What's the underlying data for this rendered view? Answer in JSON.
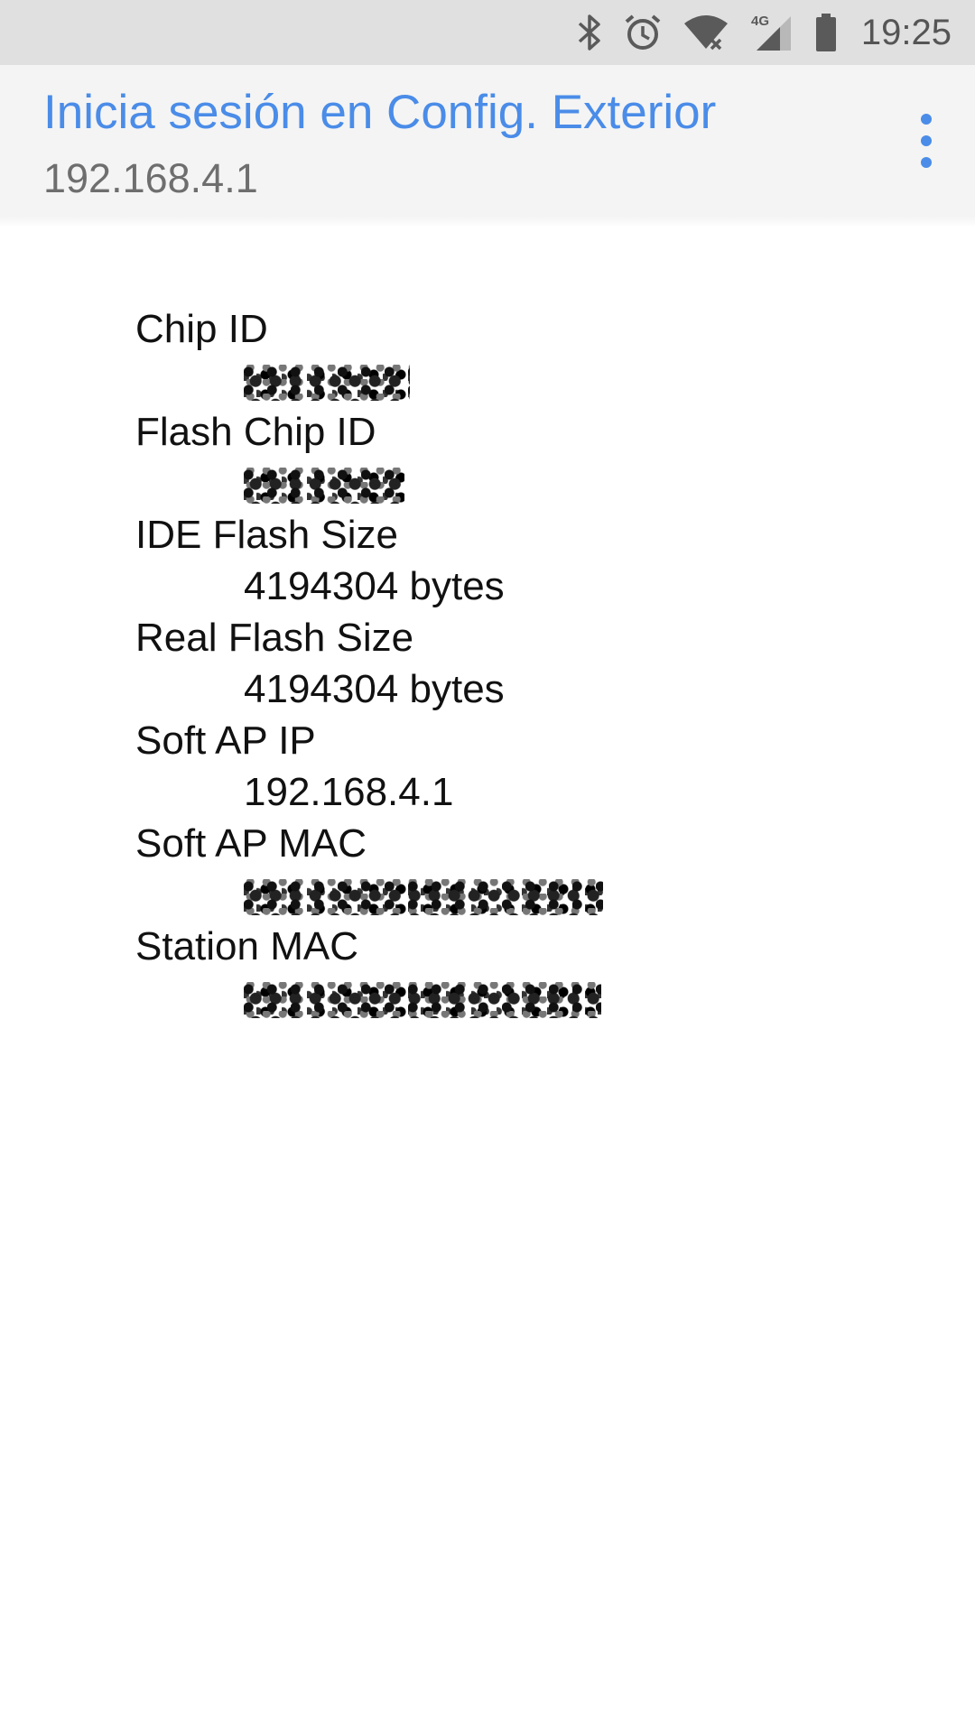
{
  "status_bar": {
    "time": "19:25",
    "icons": [
      "bluetooth-icon",
      "alarm-icon",
      "wifi-no-internet-icon",
      "signal-4g-icon",
      "battery-icon"
    ],
    "network_type": "4G"
  },
  "app_bar": {
    "title": "Inicia sesión en Config. Exterior",
    "subtitle": "192.168.4.1",
    "menu_icon": "more-vert-icon",
    "accent_color": "#4a8ce8"
  },
  "info": {
    "items": [
      {
        "label": "Chip ID",
        "value": "",
        "redacted": true
      },
      {
        "label": "Flash Chip ID",
        "value": "",
        "redacted": true
      },
      {
        "label": "IDE Flash Size",
        "value": "4194304 bytes",
        "redacted": false
      },
      {
        "label": "Real Flash Size",
        "value": "4194304 bytes",
        "redacted": false
      },
      {
        "label": "Soft AP IP",
        "value": "192.168.4.1",
        "redacted": false
      },
      {
        "label": "Soft AP MAC",
        "value": "",
        "redacted": true
      },
      {
        "label": "Station MAC",
        "value": "",
        "redacted": true
      }
    ]
  }
}
